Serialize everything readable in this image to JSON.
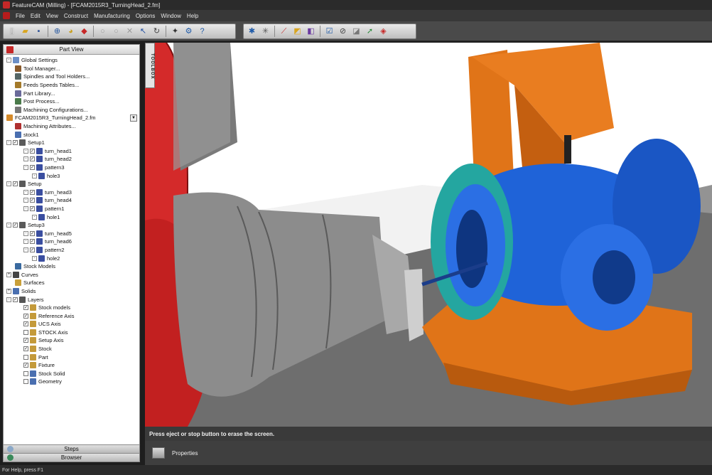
{
  "window": {
    "title": "FeatureCAM (Milling) - [FCAM2015R3_TurningHead_2.fm]"
  },
  "menu": [
    "File",
    "Edit",
    "View",
    "Construct",
    "Manufacturing",
    "Options",
    "Window",
    "Help"
  ],
  "part_view": {
    "title": "Part View",
    "tree": [
      {
        "label": "Global Settings",
        "level": 0,
        "exp": "-",
        "icon": "globe-icon",
        "color": "#6b8fc7"
      },
      {
        "label": "Tool Manager...",
        "level": 1,
        "icon": "tool-icon",
        "color": "#8a5a2b"
      },
      {
        "label": "Spindles and Tool Holders...",
        "level": 1,
        "icon": "spindle-icon",
        "color": "#566"
      },
      {
        "label": "Feeds  Speeds Tables...",
        "level": 1,
        "icon": "feeds-icon",
        "color": "#a47a2a"
      },
      {
        "label": "Part Library...",
        "level": 1,
        "icon": "library-icon",
        "color": "#6a6a9a"
      },
      {
        "label": "Post Process...",
        "level": 1,
        "icon": "post-icon",
        "color": "#4a7a4a"
      },
      {
        "label": "Machining Configurations...",
        "level": 1,
        "icon": "config-icon",
        "color": "#777"
      },
      {
        "label": "FCAM2015R3_TurningHead_2.fm",
        "level": 0,
        "icon": "document-icon",
        "color": "#d58a2a",
        "dropdown": true
      },
      {
        "label": "Machining Attributes...",
        "level": 1,
        "icon": "attributes-icon",
        "color": "#b03030"
      },
      {
        "label": "stock1",
        "level": 1,
        "icon": "stock-icon",
        "color": "#4a6fb0"
      },
      {
        "label": "Setup1",
        "level": 0,
        "exp": "-",
        "check": true,
        "icon": "setup-icon",
        "color": "#5a5a5a"
      },
      {
        "label": "turn_head1",
        "level": 2,
        "exp": "-",
        "check": true,
        "icon": "feature-icon",
        "color": "#3a4ea0"
      },
      {
        "label": "turn_head2",
        "level": 2,
        "exp": "-",
        "check": true,
        "icon": "feature-icon",
        "color": "#3a4ea0"
      },
      {
        "label": "pattern3",
        "level": 2,
        "exp": "-",
        "check": true,
        "icon": "pattern-icon",
        "color": "#3a4ea0"
      },
      {
        "label": "hole3",
        "level": 3,
        "exp": "-",
        "icon": "hole-icon",
        "color": "#3a4ea0"
      },
      {
        "label": "Setup",
        "level": 0,
        "exp": "-",
        "check": true,
        "icon": "setup-icon",
        "color": "#5a5a5a"
      },
      {
        "label": "turn_head3",
        "level": 2,
        "exp": "-",
        "check": true,
        "icon": "feature-icon",
        "color": "#3a4ea0"
      },
      {
        "label": "turn_head4",
        "level": 2,
        "exp": "-",
        "check": true,
        "icon": "feature-icon",
        "color": "#3a4ea0"
      },
      {
        "label": "pattern1",
        "level": 2,
        "exp": "-",
        "check": true,
        "icon": "pattern-icon",
        "color": "#3a4ea0"
      },
      {
        "label": "hole1",
        "level": 3,
        "exp": "-",
        "icon": "hole-icon",
        "color": "#3a4ea0"
      },
      {
        "label": "Setup3",
        "level": 0,
        "exp": "-",
        "check": true,
        "icon": "setup-icon",
        "color": "#5a5a5a"
      },
      {
        "label": "turn_head5",
        "level": 2,
        "exp": "-",
        "check": true,
        "icon": "feature-icon",
        "color": "#3a4ea0"
      },
      {
        "label": "turn_head6",
        "level": 2,
        "exp": "-",
        "check": true,
        "icon": "feature-icon",
        "color": "#3a4ea0"
      },
      {
        "label": "pattern2",
        "level": 2,
        "exp": "-",
        "check": true,
        "icon": "pattern-icon",
        "color": "#3a4ea0"
      },
      {
        "label": "hole2",
        "level": 3,
        "exp": "-",
        "icon": "hole-icon",
        "color": "#3a4ea0"
      },
      {
        "label": "Stock Models",
        "level": 1,
        "icon": "stock-models-icon",
        "color": "#3a6aa0"
      },
      {
        "label": "Curves",
        "level": 0,
        "exp": "+",
        "icon": "curves-icon",
        "color": "#444"
      },
      {
        "label": "Surfaces",
        "level": 1,
        "icon": "surfaces-icon",
        "color": "#c9a03a"
      },
      {
        "label": "Solids",
        "level": 0,
        "exp": "+",
        "icon": "solids-icon",
        "color": "#4a6fb0"
      },
      {
        "label": "Layers",
        "level": 0,
        "exp": "-",
        "check": true,
        "icon": "layers-icon",
        "color": "#555"
      },
      {
        "label": "Stock models",
        "level": 2,
        "check": true,
        "icon": "layer-icon",
        "color": "#c49a3a"
      },
      {
        "label": "Reference Axis",
        "level": 2,
        "check": true,
        "icon": "layer-icon",
        "color": "#c49a3a"
      },
      {
        "label": "UCS Axis",
        "level": 2,
        "check": true,
        "icon": "layer-icon",
        "color": "#c49a3a"
      },
      {
        "label": "STOCK Axis",
        "level": 2,
        "check": false,
        "icon": "layer-icon",
        "color": "#c49a3a"
      },
      {
        "label": "Setup Axis",
        "level": 2,
        "check": true,
        "icon": "layer-icon",
        "color": "#c49a3a"
      },
      {
        "label": "Stock",
        "level": 2,
        "check": true,
        "icon": "layer-icon",
        "color": "#c49a3a"
      },
      {
        "label": "Part",
        "level": 2,
        "check": false,
        "icon": "layer-icon",
        "color": "#c49a3a"
      },
      {
        "label": "Fixture",
        "level": 2,
        "check": true,
        "icon": "layer-icon",
        "color": "#c49a3a"
      },
      {
        "label": "Stock Solid",
        "level": 2,
        "check": false,
        "icon": "layer-icon",
        "color": "#4a6fb0"
      },
      {
        "label": "Geometry",
        "level": 2,
        "check": false,
        "icon": "layer-icon",
        "color": "#4a6fb0"
      }
    ],
    "footer_tabs": [
      {
        "label": "Steps",
        "icon": "steps-icon"
      },
      {
        "label": "Browser",
        "icon": "browser-icon"
      }
    ]
  },
  "toolbox_label": "TOOLBOX",
  "message": "Press eject or stop button to erase the screen.",
  "properties_label": "Properties",
  "status": "For Help, press F1",
  "colors": {
    "chuck_red": "#d42a2a",
    "fixture_orange": "#e07418",
    "part_blue": "#1f63d8",
    "ring_teal": "#24a6a0",
    "tool_gray": "#8a8a8a",
    "floor_gray": "#6e6e6e"
  }
}
